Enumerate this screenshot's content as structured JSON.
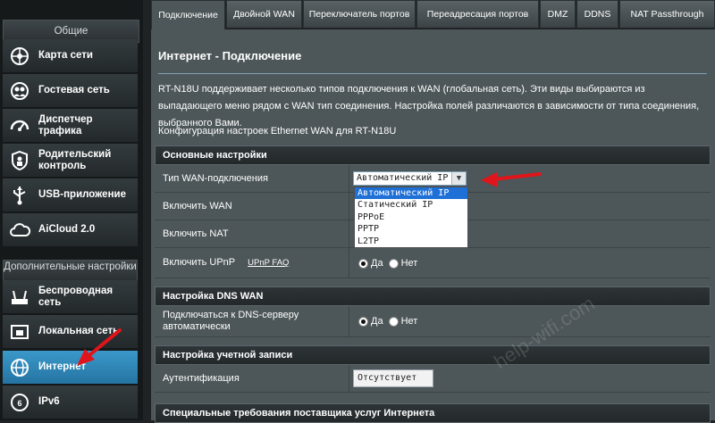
{
  "sidebar": {
    "general_header": "Общие",
    "advanced_header": "Дополнительные настройки",
    "items": [
      {
        "label": "Карта сети",
        "icon": "network-map-icon"
      },
      {
        "label": "Гостевая сеть",
        "icon": "guest-network-icon"
      },
      {
        "label": "Диспетчер трафика",
        "icon": "traffic-manager-icon"
      },
      {
        "label": "Родительский контроль",
        "icon": "parental-control-icon"
      },
      {
        "label": "USB-приложение",
        "icon": "usb-app-icon"
      },
      {
        "label": "AiCloud 2.0",
        "icon": "cloud-icon"
      }
    ],
    "advanced_items": [
      {
        "label": "Беспроводная сеть",
        "icon": "wireless-icon"
      },
      {
        "label": "Локальная сеть",
        "icon": "lan-icon"
      },
      {
        "label": "Интернет",
        "icon": "globe-icon",
        "active": true
      },
      {
        "label": "IPv6",
        "icon": "ipv6-icon"
      }
    ]
  },
  "tabs": [
    {
      "label": "Подключение",
      "active": true
    },
    {
      "label": "Двойной WAN"
    },
    {
      "label": "Переключатель портов"
    },
    {
      "label": "Переадресация портов"
    },
    {
      "label": "DMZ"
    },
    {
      "label": "DDNS"
    },
    {
      "label": "NAT Passthrough"
    }
  ],
  "content": {
    "title": "Интернет - Подключение",
    "description": "RT-N18U поддерживает несколько типов подключения к WAN (глобальная сеть). Эти виды выбираются из выпадающего меню рядом с WAN тип соединения. Настройка полей различаются в зависимости от типа соединения, выбранного Вами.",
    "config_note": "Конфигурация настроек Ethernet WAN для RT-N18U",
    "basic_section": {
      "header": "Основные настройки",
      "wan_type_label": "Тип WAN-подключения",
      "wan_type_value": "Автоматический IP",
      "wan_type_options": [
        "Автоматический IP",
        "Статический IP",
        "PPPoE",
        "PPTP",
        "L2TP"
      ],
      "enable_wan_label": "Включить WAN",
      "enable_nat_label": "Включить NAT",
      "enable_upnp_label": "Включить UPnP",
      "upnp_faq_link": "UPnP FAQ",
      "yes_label": "Да",
      "no_label": "Нет"
    },
    "dns_section": {
      "header": "Настройка DNS WAN",
      "auto_dns_label": "Подключаться к DNS-серверу автоматически",
      "yes_label": "Да",
      "no_label": "Нет"
    },
    "account_section": {
      "header": "Настройка учетной записи",
      "auth_label": "Аутентификация",
      "auth_value": "Отсутствует"
    },
    "isp_section": {
      "header": "Специальные требования поставщика услуг Интернета"
    }
  },
  "watermark": "help-wifi.com",
  "colors": {
    "accent": "#2a82b8",
    "highlight": "#1f70d6",
    "arrow": "#e0151b"
  }
}
